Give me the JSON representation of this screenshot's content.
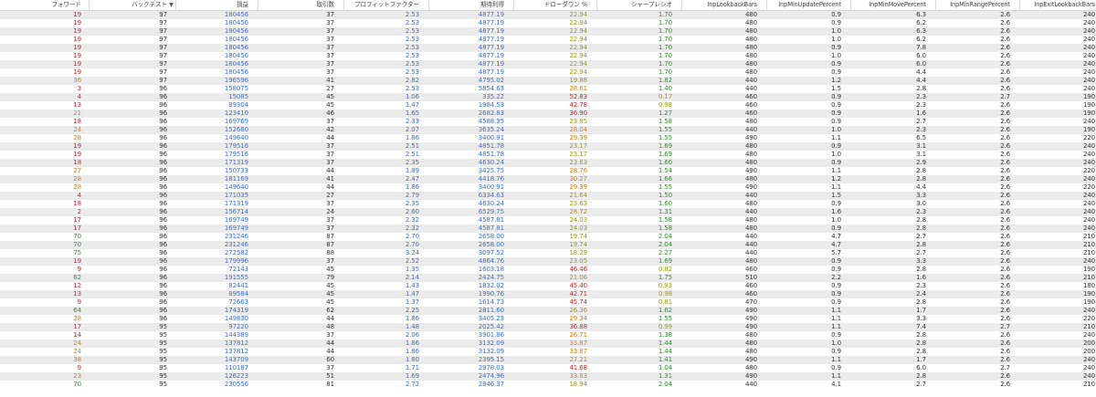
{
  "columns": [
    {
      "key": "fwd",
      "label": "フォワード"
    },
    {
      "key": "bt",
      "label": "バックテスト",
      "sorted": "desc"
    },
    {
      "key": "pnl",
      "label": "損益"
    },
    {
      "key": "trades",
      "label": "取引数"
    },
    {
      "key": "pf",
      "label": "プロフィットファクター"
    },
    {
      "key": "exp",
      "label": "期待利得"
    },
    {
      "key": "dd",
      "label": "ドローダウン %"
    },
    {
      "key": "sharpe",
      "label": "シャープレシオ"
    },
    {
      "key": "lookback",
      "label": "InpLookbackBars"
    },
    {
      "key": "upd",
      "label": "InpMinUpdatePercent"
    },
    {
      "key": "move",
      "label": "InpMinMovePercent"
    },
    {
      "key": "range",
      "label": "InpMinRangePercent"
    },
    {
      "key": "exit",
      "label": "InpExitLookbackBars"
    }
  ],
  "sort_icon": "sort-down-icon",
  "colors": {
    "blue": "#3d6fd0",
    "green": "#3a8a35",
    "orange": "#d4801f",
    "red": "#c8282a",
    "olive": "#9a9a22",
    "dark": "#333333",
    "stripe": "#ebebeb"
  },
  "rows": [
    {
      "fwd": "19",
      "bt": "97",
      "pnl": "180456",
      "trades": "37",
      "pf": "2.53",
      "exp": "4877.19",
      "dd": "22.94",
      "sharpe": "1.70",
      "lookback": "480",
      "upd": "0.9",
      "move": "6.3",
      "range": "2.6",
      "exit": "240"
    },
    {
      "fwd": "19",
      "bt": "97",
      "pnl": "180456",
      "trades": "37",
      "pf": "2.53",
      "exp": "4877.19",
      "dd": "22.94",
      "sharpe": "1.70",
      "lookback": "480",
      "upd": "0.9",
      "move": "6.2",
      "range": "2.6",
      "exit": "240"
    },
    {
      "fwd": "19",
      "bt": "97",
      "pnl": "180456",
      "trades": "37",
      "pf": "2.53",
      "exp": "4877.19",
      "dd": "22.94",
      "sharpe": "1.70",
      "lookback": "480",
      "upd": "1.0",
      "move": "6.3",
      "range": "2.6",
      "exit": "240"
    },
    {
      "fwd": "19",
      "bt": "97",
      "pnl": "180456",
      "trades": "37",
      "pf": "2.53",
      "exp": "4877.19",
      "dd": "22.94",
      "sharpe": "1.70",
      "lookback": "480",
      "upd": "1.0",
      "move": "6.2",
      "range": "2.6",
      "exit": "240"
    },
    {
      "fwd": "19",
      "bt": "97",
      "pnl": "180456",
      "trades": "37",
      "pf": "2.53",
      "exp": "4877.19",
      "dd": "22.94",
      "sharpe": "1.70",
      "lookback": "480",
      "upd": "0.9",
      "move": "7.8",
      "range": "2.6",
      "exit": "240"
    },
    {
      "fwd": "19",
      "bt": "97",
      "pnl": "180456",
      "trades": "37",
      "pf": "2.53",
      "exp": "4877.19",
      "dd": "22.94",
      "sharpe": "1.70",
      "lookback": "480",
      "upd": "1.0",
      "move": "6.0",
      "range": "2.6",
      "exit": "240"
    },
    {
      "fwd": "19",
      "bt": "97",
      "pnl": "180456",
      "trades": "37",
      "pf": "2.53",
      "exp": "4877.19",
      "dd": "22.94",
      "sharpe": "1.70",
      "lookback": "480",
      "upd": "0.9",
      "move": "6.0",
      "range": "2.6",
      "exit": "240"
    },
    {
      "fwd": "19",
      "bt": "97",
      "pnl": "180456",
      "trades": "37",
      "pf": "2.53",
      "exp": "4877.19",
      "dd": "22.94",
      "sharpe": "1.70",
      "lookback": "480",
      "upd": "0.9",
      "move": "4.4",
      "range": "2.6",
      "exit": "240"
    },
    {
      "fwd": "36",
      "bt": "97",
      "pnl": "196596",
      "trades": "41",
      "pf": "2.82",
      "exp": "4795.02",
      "dd": "19.88",
      "sharpe": "1.82",
      "lookback": "440",
      "upd": "1.2",
      "move": "4.4",
      "range": "2.6",
      "exit": "240"
    },
    {
      "fwd": "3",
      "bt": "96",
      "pnl": "158075",
      "trades": "27",
      "pf": "2.53",
      "exp": "5854.63",
      "dd": "28.61",
      "sharpe": "1.40",
      "lookback": "440",
      "upd": "1.5",
      "move": "2.8",
      "range": "2.6",
      "exit": "240"
    },
    {
      "fwd": "4",
      "bt": "96",
      "pnl": "15085",
      "trades": "45",
      "pf": "1.06",
      "exp": "335.22",
      "dd": "52.83",
      "sharpe": "0.17",
      "lookback": "460",
      "upd": "0.9",
      "move": "2.3",
      "range": "2.7",
      "exit": "190"
    },
    {
      "fwd": "13",
      "bt": "96",
      "pnl": "89304",
      "trades": "45",
      "pf": "1.47",
      "exp": "1984.53",
      "dd": "42.78",
      "sharpe": "0.98",
      "lookback": "460",
      "upd": "0.9",
      "move": "2.3",
      "range": "2.6",
      "exit": "190"
    },
    {
      "fwd": "21",
      "bt": "96",
      "pnl": "123410",
      "trades": "46",
      "pf": "1.65",
      "exp": "2682.83",
      "dd": "36.90",
      "sharpe": "1.27",
      "lookback": "460",
      "upd": "0.9",
      "move": "1.6",
      "range": "2.6",
      "exit": "190"
    },
    {
      "fwd": "18",
      "bt": "96",
      "pnl": "169769",
      "trades": "37",
      "pf": "2.33",
      "exp": "4588.35",
      "dd": "23.85",
      "sharpe": "1.58",
      "lookback": "480",
      "upd": "0.9",
      "move": "2.7",
      "range": "2.6",
      "exit": "240"
    },
    {
      "fwd": "24",
      "bt": "96",
      "pnl": "152680",
      "trades": "42",
      "pf": "2.07",
      "exp": "3635.24",
      "dd": "28.04",
      "sharpe": "1.55",
      "lookback": "440",
      "upd": "1.0",
      "move": "2.3",
      "range": "2.6",
      "exit": "190"
    },
    {
      "fwd": "28",
      "bt": "96",
      "pnl": "149640",
      "trades": "44",
      "pf": "1.86",
      "exp": "3400.91",
      "dd": "29.39",
      "sharpe": "1.55",
      "lookback": "490",
      "upd": "1.1",
      "move": "6.5",
      "range": "2.6",
      "exit": "220"
    },
    {
      "fwd": "19",
      "bt": "96",
      "pnl": "179516",
      "trades": "37",
      "pf": "2.51",
      "exp": "4851.78",
      "dd": "23.17",
      "sharpe": "1.69",
      "lookback": "480",
      "upd": "0.9",
      "move": "3.1",
      "range": "2.6",
      "exit": "240"
    },
    {
      "fwd": "19",
      "bt": "96",
      "pnl": "179516",
      "trades": "37",
      "pf": "2.51",
      "exp": "4851.78",
      "dd": "23.17",
      "sharpe": "1.69",
      "lookback": "480",
      "upd": "1.0",
      "move": "3.1",
      "range": "2.6",
      "exit": "240"
    },
    {
      "fwd": "18",
      "bt": "96",
      "pnl": "171319",
      "trades": "37",
      "pf": "2.35",
      "exp": "4630.24",
      "dd": "23.63",
      "sharpe": "1.60",
      "lookback": "480",
      "upd": "0.9",
      "move": "2.9",
      "range": "2.6",
      "exit": "240"
    },
    {
      "fwd": "27",
      "bt": "96",
      "pnl": "150733",
      "trades": "44",
      "pf": "1.89",
      "exp": "3425.75",
      "dd": "28.76",
      "sharpe": "1.54",
      "lookback": "490",
      "upd": "1.1",
      "move": "2.8",
      "range": "2.6",
      "exit": "220"
    },
    {
      "fwd": "28",
      "bt": "96",
      "pnl": "181169",
      "trades": "41",
      "pf": "2.47",
      "exp": "4418.76",
      "dd": "30.27",
      "sharpe": "1.66",
      "lookback": "480",
      "upd": "1.2",
      "move": "2.8",
      "range": "2.6",
      "exit": "240"
    },
    {
      "fwd": "28",
      "bt": "96",
      "pnl": "149640",
      "trades": "44",
      "pf": "1.86",
      "exp": "3400.91",
      "dd": "29.39",
      "sharpe": "1.55",
      "lookback": "490",
      "upd": "1.1",
      "move": "4.4",
      "range": "2.6",
      "exit": "220"
    },
    {
      "fwd": "4",
      "bt": "96",
      "pnl": "171035",
      "trades": "27",
      "pf": "2.79",
      "exp": "6334.63",
      "dd": "21.64",
      "sharpe": "1.50",
      "lookback": "440",
      "upd": "1.5",
      "move": "3.3",
      "range": "2.6",
      "exit": "240"
    },
    {
      "fwd": "18",
      "bt": "96",
      "pnl": "171319",
      "trades": "37",
      "pf": "2.35",
      "exp": "4630.24",
      "dd": "23.63",
      "sharpe": "1.60",
      "lookback": "480",
      "upd": "0.9",
      "move": "3.0",
      "range": "2.6",
      "exit": "240"
    },
    {
      "fwd": "2",
      "bt": "96",
      "pnl": "156714",
      "trades": "24",
      "pf": "2.60",
      "exp": "6529.75",
      "dd": "28.72",
      "sharpe": "1.31",
      "lookback": "440",
      "upd": "1.6",
      "move": "2.3",
      "range": "2.6",
      "exit": "240"
    },
    {
      "fwd": "17",
      "bt": "96",
      "pnl": "169749",
      "trades": "37",
      "pf": "2.32",
      "exp": "4587.81",
      "dd": "24.03",
      "sharpe": "1.58",
      "lookback": "480",
      "upd": "1.0",
      "move": "2.8",
      "range": "2.6",
      "exit": "240"
    },
    {
      "fwd": "17",
      "bt": "96",
      "pnl": "169749",
      "trades": "37",
      "pf": "2.32",
      "exp": "4587.81",
      "dd": "24.03",
      "sharpe": "1.58",
      "lookback": "480",
      "upd": "0.9",
      "move": "2.8",
      "range": "2.6",
      "exit": "240"
    },
    {
      "fwd": "70",
      "bt": "96",
      "pnl": "231246",
      "trades": "87",
      "pf": "2.70",
      "exp": "2658.00",
      "dd": "19.74",
      "sharpe": "2.04",
      "lookback": "440",
      "upd": "4.7",
      "move": "2.7",
      "range": "2.6",
      "exit": "210"
    },
    {
      "fwd": "70",
      "bt": "96",
      "pnl": "231246",
      "trades": "87",
      "pf": "2.70",
      "exp": "2658.00",
      "dd": "19.74",
      "sharpe": "2.04",
      "lookback": "440",
      "upd": "4.7",
      "move": "2.8",
      "range": "2.6",
      "exit": "210"
    },
    {
      "fwd": "75",
      "bt": "96",
      "pnl": "272582",
      "trades": "88",
      "pf": "3.24",
      "exp": "3097.52",
      "dd": "18.29",
      "sharpe": "2.27",
      "lookback": "440",
      "upd": "5.7",
      "move": "2.7",
      "range": "2.6",
      "exit": "210"
    },
    {
      "fwd": "19",
      "bt": "96",
      "pnl": "179996",
      "trades": "37",
      "pf": "2.52",
      "exp": "4864.76",
      "dd": "23.05",
      "sharpe": "1.69",
      "lookback": "480",
      "upd": "0.9",
      "move": "3.3",
      "range": "2.6",
      "exit": "240"
    },
    {
      "fwd": "9",
      "bt": "96",
      "pnl": "72143",
      "trades": "45",
      "pf": "1.35",
      "exp": "1603.18",
      "dd": "46.46",
      "sharpe": "0.82",
      "lookback": "460",
      "upd": "0.9",
      "move": "2.8",
      "range": "2.6",
      "exit": "190"
    },
    {
      "fwd": "62",
      "bt": "96",
      "pnl": "191555",
      "trades": "79",
      "pf": "2.14",
      "exp": "2424.75",
      "dd": "21.06",
      "sharpe": "1.75",
      "lookback": "510",
      "upd": "2.2",
      "move": "1.6",
      "range": "2.6",
      "exit": "210"
    },
    {
      "fwd": "12",
      "bt": "96",
      "pnl": "82441",
      "trades": "45",
      "pf": "1.43",
      "exp": "1832.02",
      "dd": "45.40",
      "sharpe": "0.93",
      "lookback": "460",
      "upd": "0.9",
      "move": "2.3",
      "range": "2.6",
      "exit": "180"
    },
    {
      "fwd": "13",
      "bt": "96",
      "pnl": "89584",
      "trades": "45",
      "pf": "1.47",
      "exp": "1990.76",
      "dd": "42.71",
      "sharpe": "0.98",
      "lookback": "460",
      "upd": "0.9",
      "move": "2.4",
      "range": "2.6",
      "exit": "190"
    },
    {
      "fwd": "9",
      "bt": "96",
      "pnl": "72663",
      "trades": "45",
      "pf": "1.37",
      "exp": "1614.73",
      "dd": "45.74",
      "sharpe": "0.81",
      "lookback": "470",
      "upd": "0.9",
      "move": "2.8",
      "range": "2.6",
      "exit": "190"
    },
    {
      "fwd": "64",
      "bt": "96",
      "pnl": "174319",
      "trades": "62",
      "pf": "2.25",
      "exp": "2811.60",
      "dd": "26.36",
      "sharpe": "1.62",
      "lookback": "490",
      "upd": "1.1",
      "move": "1.7",
      "range": "2.6",
      "exit": "240"
    },
    {
      "fwd": "28",
      "bt": "96",
      "pnl": "149830",
      "trades": "44",
      "pf": "1.86",
      "exp": "3405.23",
      "dd": "29.34",
      "sharpe": "1.55",
      "lookback": "490",
      "upd": "1.1",
      "move": "3.3",
      "range": "2.6",
      "exit": "220"
    },
    {
      "fwd": "17",
      "bt": "95",
      "pnl": "97220",
      "trades": "48",
      "pf": "1.48",
      "exp": "2025.42",
      "dd": "36.88",
      "sharpe": "0.99",
      "lookback": "490",
      "upd": "1.1",
      "move": "7.4",
      "range": "2.7",
      "exit": "210"
    },
    {
      "fwd": "14",
      "bt": "95",
      "pnl": "144389",
      "trades": "37",
      "pf": "2.06",
      "exp": "3901.86",
      "dd": "26.71",
      "sharpe": "1.38",
      "lookback": "480",
      "upd": "0.9",
      "move": "2.8",
      "range": "2.6",
      "exit": "240"
    },
    {
      "fwd": "24",
      "bt": "95",
      "pnl": "137812",
      "trades": "44",
      "pf": "1.86",
      "exp": "3132.09",
      "dd": "33.87",
      "sharpe": "1.44",
      "lookback": "480",
      "upd": "1.0",
      "move": "2.8",
      "range": "2.6",
      "exit": "200"
    },
    {
      "fwd": "24",
      "bt": "95",
      "pnl": "137812",
      "trades": "44",
      "pf": "1.86",
      "exp": "3132.09",
      "dd": "33.87",
      "sharpe": "1.44",
      "lookback": "480",
      "upd": "0.9",
      "move": "2.8",
      "range": "2.6",
      "exit": "200"
    },
    {
      "fwd": "38",
      "bt": "95",
      "pnl": "143709",
      "trades": "60",
      "pf": "1.80",
      "exp": "2395.15",
      "dd": "27.21",
      "sharpe": "1.41",
      "lookback": "490",
      "upd": "1.1",
      "move": "1.7",
      "range": "2.6",
      "exit": "240"
    },
    {
      "fwd": "9",
      "bt": "95",
      "pnl": "110187",
      "trades": "37",
      "pf": "1.71",
      "exp": "2978.03",
      "dd": "41.68",
      "sharpe": "1.04",
      "lookback": "480",
      "upd": "0.9",
      "move": "6.0",
      "range": "2.7",
      "exit": "240"
    },
    {
      "fwd": "23",
      "bt": "95",
      "pnl": "126223",
      "trades": "51",
      "pf": "1.69",
      "exp": "2474.96",
      "dd": "33.83",
      "sharpe": "1.31",
      "lookback": "490",
      "upd": "1.1",
      "move": "2.8",
      "range": "2.6",
      "exit": "240"
    },
    {
      "fwd": "70",
      "bt": "95",
      "pnl": "230556",
      "trades": "81",
      "pf": "2.72",
      "exp": "2846.37",
      "dd": "18.94",
      "sharpe": "2.04",
      "lookback": "440",
      "upd": "4.1",
      "move": "2.7",
      "range": "2.6",
      "exit": "210"
    }
  ]
}
